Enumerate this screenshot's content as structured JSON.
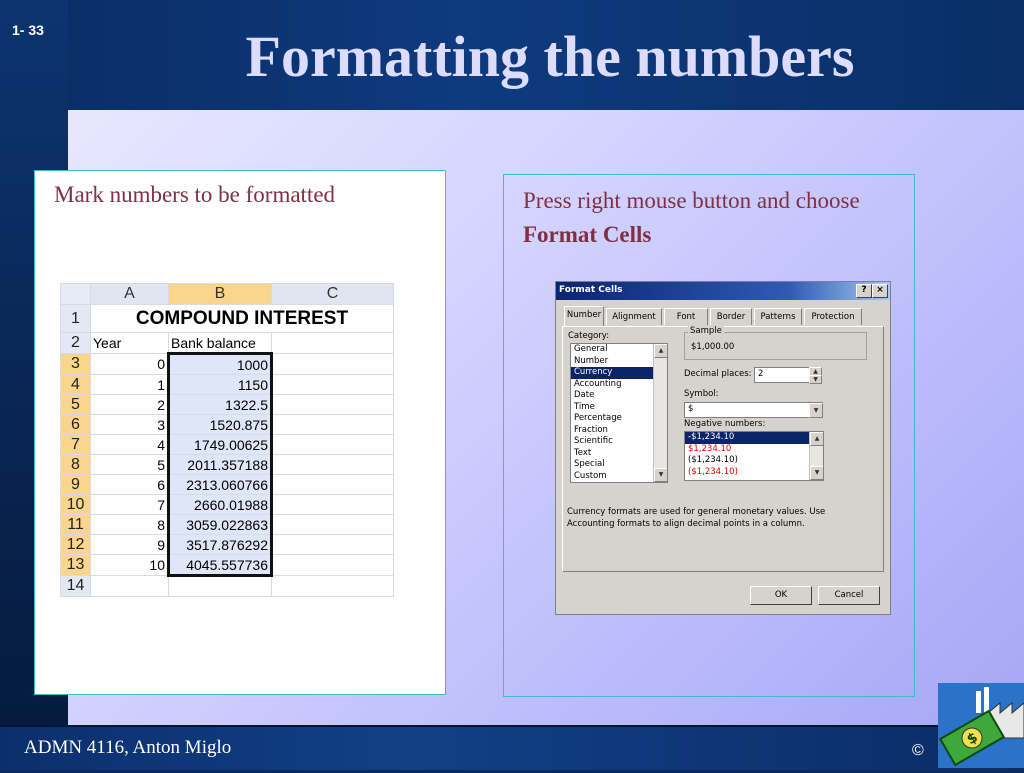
{
  "slide": {
    "number": "1- 33",
    "title": "Formatting the numbers",
    "footer": "ADMN 4116, Anton Miglo",
    "copyright": "©",
    "left_caption": "Mark numbers to be formatted",
    "right_caption_prefix": "Press right mouse button and choose ",
    "right_caption_bold": "Format Cells"
  },
  "spreadsheet": {
    "columns": [
      "A",
      "B",
      "C"
    ],
    "title": "COMPOUND INTEREST",
    "header_year": "Year",
    "header_balance": "Bank balance",
    "row_numbers": [
      "1",
      "2",
      "3",
      "4",
      "5",
      "6",
      "7",
      "8",
      "9",
      "10",
      "11",
      "12",
      "13",
      "14"
    ],
    "rows": [
      {
        "year": "0",
        "balance": "1000"
      },
      {
        "year": "1",
        "balance": "1150"
      },
      {
        "year": "2",
        "balance": "1322.5"
      },
      {
        "year": "3",
        "balance": "1520.875"
      },
      {
        "year": "4",
        "balance": "1749.00625"
      },
      {
        "year": "5",
        "balance": "2011.357188"
      },
      {
        "year": "6",
        "balance": "2313.060766"
      },
      {
        "year": "7",
        "balance": "2660.01988"
      },
      {
        "year": "8",
        "balance": "3059.022863"
      },
      {
        "year": "9",
        "balance": "3517.876292"
      },
      {
        "year": "10",
        "balance": "4045.557736"
      }
    ]
  },
  "dialog": {
    "title": "Format Cells",
    "help": "?",
    "close": "×",
    "tabs": [
      "Number",
      "Alignment",
      "Font",
      "Border",
      "Patterns",
      "Protection"
    ],
    "category_label": "Category:",
    "categories": [
      "General",
      "Number",
      "Currency",
      "Accounting",
      "Date",
      "Time",
      "Percentage",
      "Fraction",
      "Scientific",
      "Text",
      "Special",
      "Custom"
    ],
    "selected_category": "Currency",
    "sample_label": "Sample",
    "sample_value": "$1,000.00",
    "decimal_label": "Decimal places:",
    "decimal_value": "2",
    "symbol_label": "Symbol:",
    "symbol_value": "$",
    "negative_label": "Negative numbers:",
    "negative_options": [
      {
        "text": "-$1,234.10",
        "color": "#000000"
      },
      {
        "text": "$1,234.10",
        "color": "#e00000"
      },
      {
        "text": "($1,234.10)",
        "color": "#000000"
      },
      {
        "text": "($1,234.10)",
        "color": "#e00000"
      }
    ],
    "description": "Currency formats are used for general monetary values.  Use Accounting formats to align decimal points in a column.",
    "ok": "OK",
    "cancel": "Cancel"
  }
}
